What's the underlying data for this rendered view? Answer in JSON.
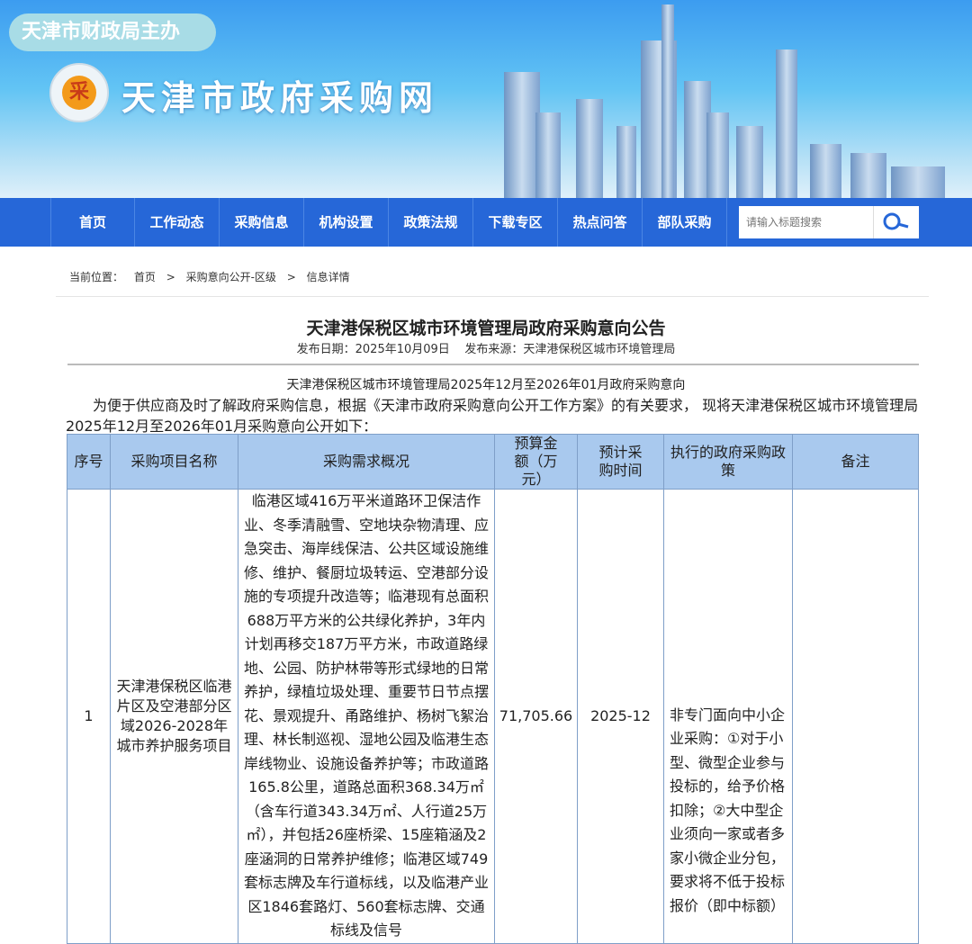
{
  "header": {
    "host": "天津市财政局主办",
    "logo_char": "采",
    "site_name": "天津市政府采购网"
  },
  "nav": {
    "items": [
      "首页",
      "工作动态",
      "采购信息",
      "机构设置",
      "政策法规",
      "下载专区",
      "热点问答",
      "部队采购"
    ],
    "search_placeholder": "请输入标题搜索"
  },
  "breadcrumb": {
    "label": "当前位置：",
    "items": [
      "首页",
      ">",
      "采购意向公开-区级",
      ">",
      "信息详情"
    ]
  },
  "article": {
    "title": "天津港保税区城市环境管理局政府采购意向公告",
    "publish_date": "发布日期：2025年10月09日",
    "source": "发布来源：天津港保税区城市环境管理局",
    "subtitle": "天津港保税区城市环境管理局2025年12月至2026年01月政府采购意向",
    "intro": "为便于供应商及时了解政府采购信息，根据《天津市政府采购意向公开工作方案》的有关要求， 现将天津港保税区城市环境管理局 2025年12月至2026年01月采购意向公开如下："
  },
  "table": {
    "headers": [
      "序号",
      "采购项目名称",
      "采购需求概况",
      "预算金额（万元）",
      "预计采购时间",
      "执行的政府采购政策",
      "备注"
    ],
    "rows": [
      {
        "no": "1",
        "name": "天津港保税区临港片区及空港部分区域2026-2028年城市养护服务项目",
        "desc": "临港区域416万平米道路环卫保洁作业、冬季清融雪、空地块杂物清理、应急突击、海岸线保洁、公共区域设施维修、维护、餐厨垃圾转运、空港部分设施的专项提升改造等；临港现有总面积688万平方米的公共绿化养护，3年内计划再移交187万平方米，市政道路绿地、公园、防护林带等形式绿地的日常养护，绿植垃圾处理、重要节日节点摆花、景观提升、甬路维护、杨树飞絮治理、林长制巡视、湿地公园及临港生态岸线物业、设施设备养护等；市政道路165.8公里，道路总面积368.34万㎡（含车行道343.34万㎡、人行道25万㎡），并包括26座桥梁、15座箱涵及2座涵洞的日常养护维修；临港区域749套标志牌及车行道标线，以及临港产业区1846套路灯、560套标志牌、交通标线及信号",
        "budget": "71,705.66",
        "time": "2025-12",
        "policy": "非专门面向中小企业采购：①对于小型、微型企业参与投标的，给予价格扣除；②大中型企业须向一家或者多家小微企业分包，要求将不低于投标报价（即中标额）",
        "remark": ""
      }
    ]
  }
}
